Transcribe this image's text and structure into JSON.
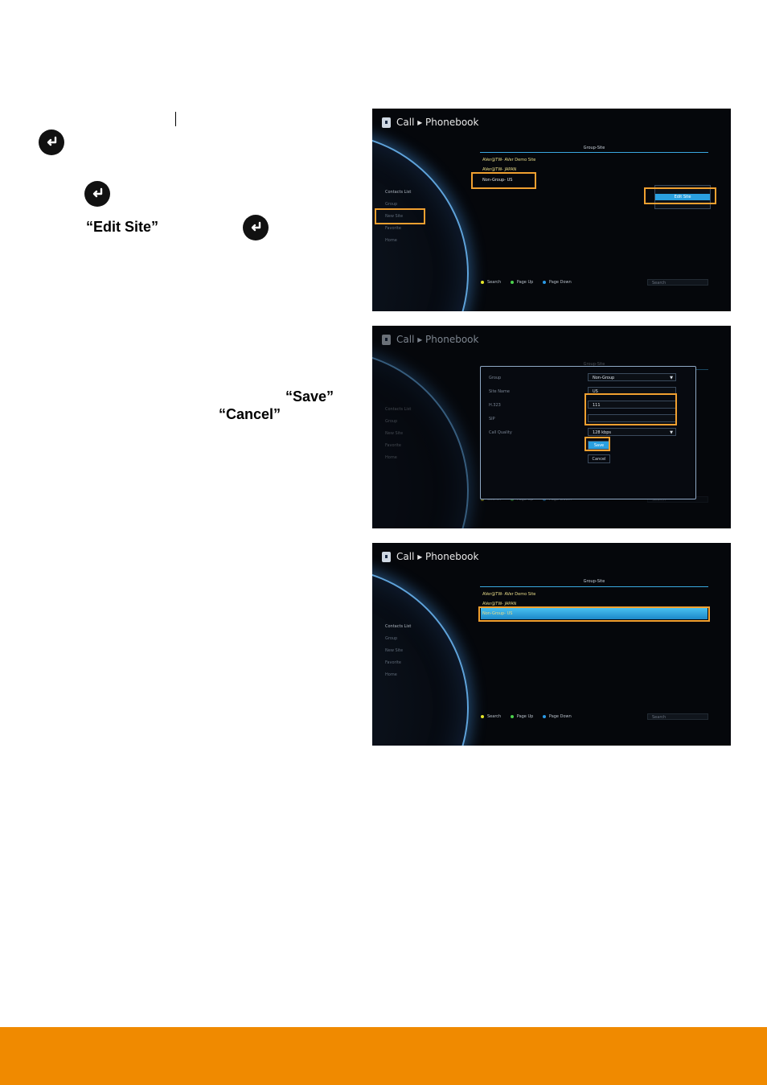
{
  "instructions": {
    "edit_site": "“Edit Site”",
    "save": "“Save”",
    "cancel": "“Cancel”"
  },
  "icons": {
    "enter": "enter-key-icon",
    "book": "phonebook-icon"
  },
  "screens": {
    "common": {
      "title": "Call ▸ Phonebook",
      "menu": [
        "Contacts List",
        "Group",
        "New Site",
        "Favorite",
        "Home"
      ],
      "group_header": "Group-Site",
      "rows": [
        "AVer@TW- AVer Demo Site",
        "AVer@TW- JAPAN",
        "Non-Group- US"
      ],
      "footer": {
        "search": "Search",
        "page_up": "Page Up",
        "page_down": "Page Down",
        "search_box": "Search"
      }
    },
    "screen1": {
      "context_menu": [
        "Edit Site"
      ]
    },
    "screen2": {
      "fields": [
        {
          "label": "Group",
          "value": "Non-Group"
        },
        {
          "label": "Site Name",
          "value": "US"
        },
        {
          "label": "H.323",
          "value": "111"
        },
        {
          "label": "SIP",
          "value": ""
        },
        {
          "label": "Call Quality",
          "value": "128 kbps"
        }
      ],
      "save_label": "Save",
      "cancel_label": "Cancel"
    }
  },
  "colors": {
    "highlight": "#f0a030",
    "accent": "#2aa0e0",
    "footer_bar": "#f08a00",
    "yellow_dot": "#e6e62a",
    "green_dot": "#4cd24c",
    "blue_dot": "#2a9ae6"
  }
}
